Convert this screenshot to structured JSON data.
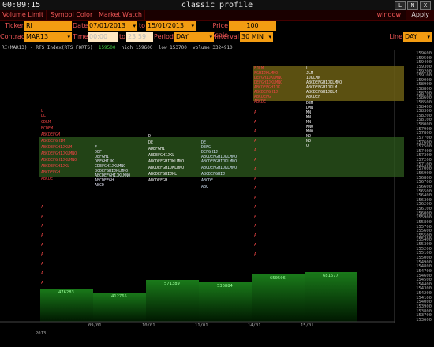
{
  "titlebar": {
    "clock": "00:09:15",
    "title": "classic profile",
    "btn_min": "L",
    "btn_max": "N",
    "btn_close": "X"
  },
  "menu": {
    "items": [
      "Volume Limit",
      "Symbol Color",
      "Market Watch"
    ],
    "window": "window",
    "apply": "Apply"
  },
  "controls": {
    "ticker_label": "Ticker",
    "ticker": "RI",
    "date_label": "Date",
    "date_from": "07/01/2013",
    "to_label": "to",
    "date_to": "15/01/2013",
    "price_scale_label": "Price Scale",
    "price_scale": "100",
    "contract_label": "Contract",
    "contract": "MAR13",
    "time_label": "Time",
    "time_from": "00:00",
    "time_to_label": "to",
    "time_to": "23:59",
    "period_label": "Period",
    "period": "DAY",
    "interval_label": "Interval",
    "interval": "30 MIN",
    "line_label": "Line",
    "line": "DAY"
  },
  "info": {
    "symbol": "RI(MAR13) - RTS Index(RTS FORTS)",
    "last": "159500",
    "high": "high 159600",
    "low": "low 153700",
    "volume": "volume 3324910"
  },
  "colors": {
    "accent": "#f39c12",
    "menu_text": "#ee5555",
    "value_area_green": "#2e5a1e",
    "value_area_yellow": "#6b5e14"
  },
  "chart_data": {
    "type": "market-profile",
    "y_ticks": [
      "159600",
      "159500",
      "159400",
      "159300",
      "159200",
      "159100",
      "159000",
      "158900",
      "158800",
      "158700",
      "158600",
      "158500",
      "158400",
      "158300",
      "158200",
      "158100",
      "158000",
      "157900",
      "157800",
      "157700",
      "157600",
      "157500",
      "157400",
      "157300",
      "157200",
      "157100",
      "157000",
      "156900",
      "156800",
      "156700",
      "156600",
      "156500",
      "156400",
      "156300",
      "156200",
      "156100",
      "156000",
      "155900",
      "155800",
      "155700",
      "155600",
      "155500",
      "155400",
      "155300",
      "155200",
      "155100",
      "155000",
      "154900",
      "154800",
      "154700",
      "154600",
      "154500",
      "154400",
      "154300",
      "154200",
      "154100",
      "154000",
      "153900",
      "153800",
      "153700",
      "153600"
    ],
    "x_ticks": [
      "2013",
      "09/01",
      "10/01",
      "11/01",
      "14/01",
      "15/01"
    ],
    "volume_labels": [
      "476283",
      "412765",
      "571389",
      "536884",
      "650506",
      "681677"
    ]
  }
}
